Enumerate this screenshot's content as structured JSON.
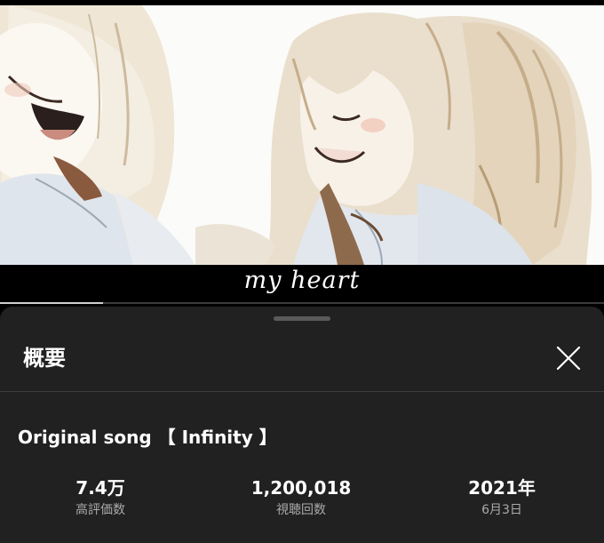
{
  "video": {
    "caption": "my heart",
    "progress_fraction": 0.17
  },
  "sheet": {
    "title": "概要",
    "close_icon": "close-icon"
  },
  "description": {
    "video_title": "Original song 【 Infinity 】",
    "stats": [
      {
        "value": "7.4万",
        "label": "高評価数"
      },
      {
        "value": "1,200,018",
        "label": "視聴回数"
      },
      {
        "value": "2021年",
        "label": "6月3日"
      }
    ]
  },
  "colors": {
    "sheet_bg": "#212121",
    "page_bg": "#000000",
    "text_primary": "#ffffff",
    "text_secondary": "#aaaaaa"
  }
}
